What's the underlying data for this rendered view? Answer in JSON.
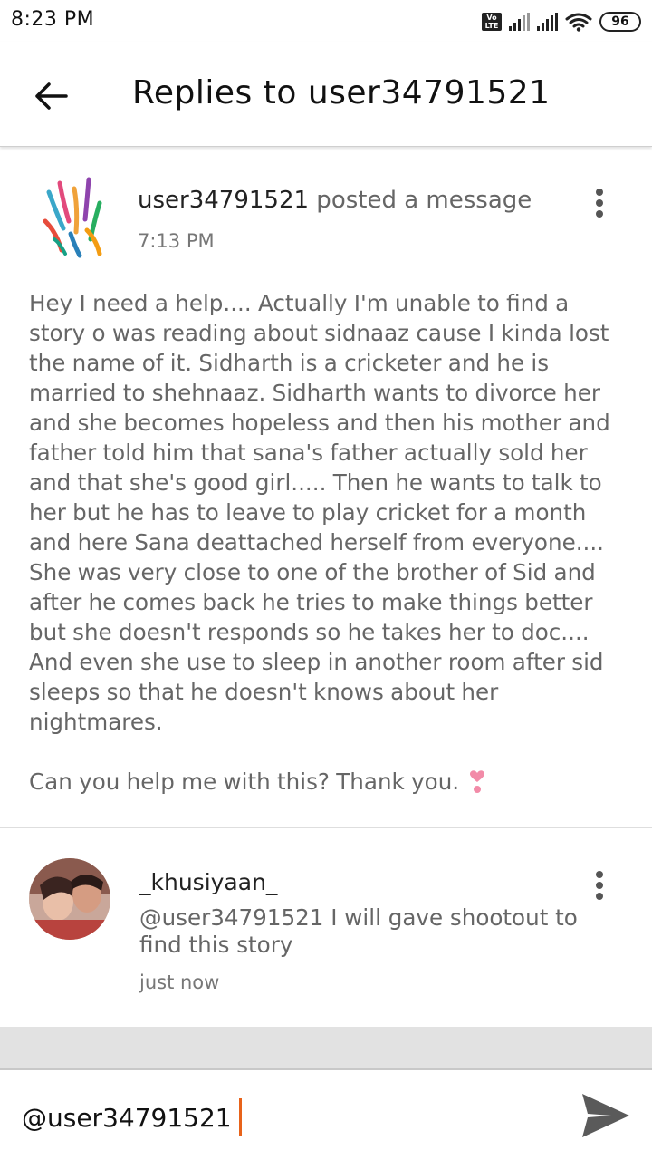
{
  "status_bar": {
    "time": "8:23 PM",
    "volte_label": "Vo\nLTE",
    "battery": "96",
    "icons": [
      "volte-icon",
      "signal-icon",
      "signal-icon",
      "wifi-icon",
      "battery-icon"
    ]
  },
  "header": {
    "back_icon": "arrow-left-icon",
    "title": "Replies to user34791521"
  },
  "post": {
    "avatar": "feathers-avatar",
    "username": "user34791521",
    "action": " posted a message",
    "time": "7:13 PM",
    "more_icon": "more-vertical-icon",
    "body_paragraph_1": "Hey I need a help.... Actually I'm unable to find a story o was reading about sidnaaz cause I kinda lost the name of it. Sidharth is a cricketer and he is married to shehnaaz. Sidharth wants to divorce her and she becomes hopeless and then his mother and father told him that sana's father actually sold her and that she's good girl..... Then he wants to talk to her but he has to leave to play cricket for a month and here Sana deattached herself from everyone.... She was very close to one of the brother of Sid and after he comes back he tries to make things better but she doesn't responds so he takes her to doc.... And even she use to sleep in another room after sid sleeps so that he doesn't knows about her nightmares.",
    "body_paragraph_2": "Can you help me with this? Thank you.",
    "emoji": "heart-exclamation-emoji"
  },
  "reply": {
    "avatar": "couple-photo-avatar",
    "username": "_khusiyaan_",
    "text": "@user34791521 I will gave shootout to find this story",
    "time": "just now",
    "more_icon": "more-vertical-icon"
  },
  "composer": {
    "value": "@user34791521",
    "send_icon": "send-icon",
    "caret_color": "#e8631a"
  }
}
